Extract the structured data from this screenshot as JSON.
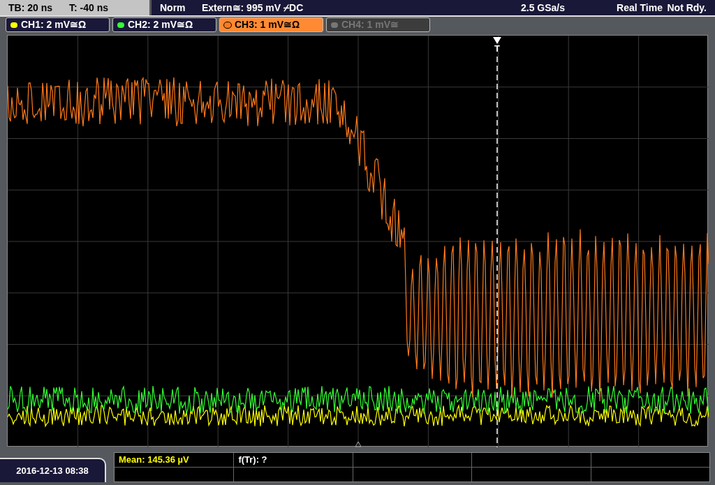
{
  "status_bar": {
    "timebase": "TB: 20 ns",
    "trigger_offset": "T: -40 ns",
    "mode": "Norm",
    "trigger_source": "Extern≅: 995 mV ⌿DC",
    "sample_rate": "2.5 GSa/s",
    "acquisition": "Real Time",
    "state": "Not Rdy."
  },
  "channels": [
    {
      "label": "CH1: 2 mV≅Ω",
      "color": "#ffff00",
      "selected": false,
      "enabled": true
    },
    {
      "label": "CH2: 2 mV≅Ω",
      "color": "#33ff33",
      "selected": false,
      "enabled": true
    },
    {
      "label": "CH3: 1 mV≅Ω",
      "color": "#ff7a1a",
      "selected": true,
      "enabled": true
    },
    {
      "label": "CH4: 1 mV≅",
      "color": "#777777",
      "selected": false,
      "enabled": false
    }
  ],
  "trigger_marker": "T",
  "footer": {
    "date": "2016-12-13 08:38"
  },
  "measurements": [
    {
      "text": "Mean: 145.36 µV",
      "kind": "active"
    },
    {
      "text": "f(Tr): ?",
      "kind": "plain"
    }
  ]
}
